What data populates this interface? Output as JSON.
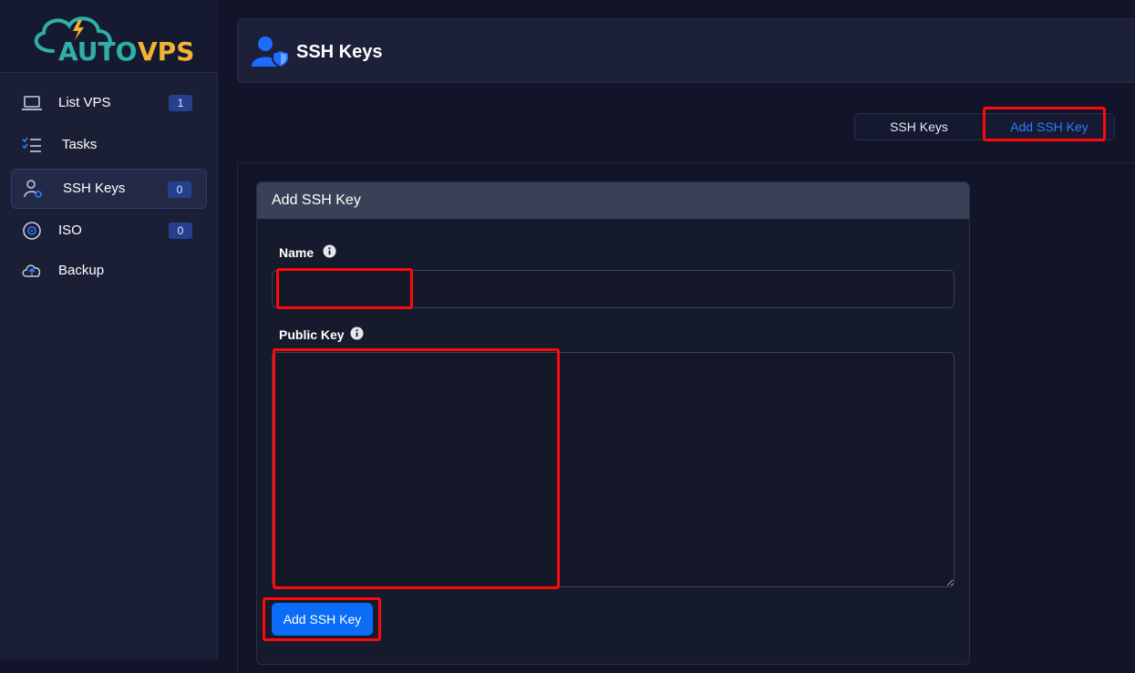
{
  "brand": {
    "logo_text_part1": "AUTO",
    "logo_text_part2": "VPS",
    "color_primary": "#2eb0a8",
    "color_secondary": "#f2b234"
  },
  "sidebar": {
    "items": [
      {
        "label": "List VPS",
        "icon": "laptop-icon",
        "badge": "1",
        "active": false
      },
      {
        "label": "Tasks",
        "icon": "tasks-icon",
        "badge": null,
        "active": false
      },
      {
        "label": "SSH Keys",
        "icon": "user-key-icon",
        "badge": "0",
        "active": true
      },
      {
        "label": "ISO",
        "icon": "disc-icon",
        "badge": "0",
        "active": false
      },
      {
        "label": "Backup",
        "icon": "cloud-upload-icon",
        "badge": null,
        "active": false
      }
    ]
  },
  "header": {
    "title": "SSH Keys",
    "icon": "user-shield-icon"
  },
  "tabs": [
    {
      "label": "SSH Keys",
      "active": false
    },
    {
      "label": "Add SSH Key",
      "active": true
    }
  ],
  "form": {
    "title": "Add SSH Key",
    "name_label": "Name",
    "name_value": "",
    "public_key_label": "Public Key",
    "public_key_value": "",
    "submit_label": "Add SSH Key"
  },
  "colors": {
    "accent": "#0b6cf8",
    "highlight": "#ff0a0a",
    "badge_bg": "#25408f"
  }
}
